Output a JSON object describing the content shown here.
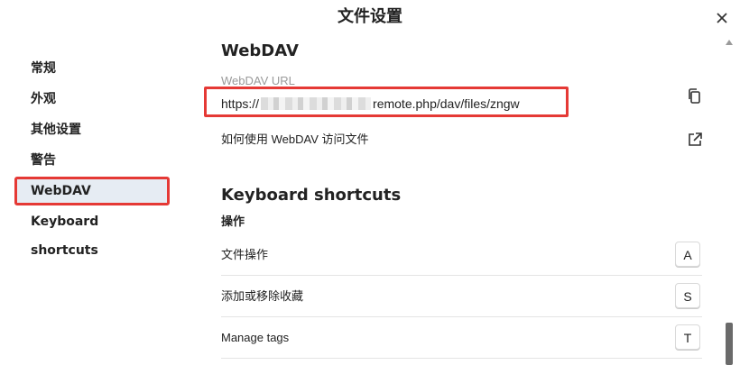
{
  "dialog": {
    "title": "文件设置"
  },
  "sidebar": {
    "items": [
      {
        "label": "常规",
        "active": false
      },
      {
        "label": "外观",
        "active": false
      },
      {
        "label": "其他设置",
        "active": false
      },
      {
        "label": "警告",
        "active": false
      },
      {
        "label": "WebDAV",
        "active": true
      },
      {
        "label": "Keyboard shortcuts",
        "active": false
      }
    ]
  },
  "webdav": {
    "title": "WebDAV",
    "url_label": "WebDAV URL",
    "url_prefix": "https://",
    "url_suffix": "remote.php/dav/files/zngw",
    "help_link": "如何使用 WebDAV 访问文件"
  },
  "shortcuts": {
    "title": "Keyboard shortcuts",
    "group": "操作",
    "items": [
      {
        "label": "文件操作",
        "key": "A"
      },
      {
        "label": "添加或移除收藏",
        "key": "S"
      },
      {
        "label": "Manage tags",
        "key": "T"
      }
    ]
  },
  "colors": {
    "highlight": "#e53935",
    "active_bg": "#e6ecf3",
    "scroll_thumb": "#6a6a6a"
  },
  "icons": {
    "close": "close-icon",
    "copy": "copy-icon",
    "external": "external-link-icon"
  }
}
